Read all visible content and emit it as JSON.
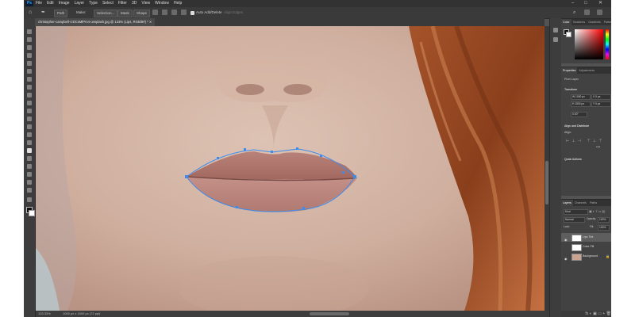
{
  "menubar": {
    "logo": "Ps",
    "items": [
      "File",
      "Edit",
      "Image",
      "Layer",
      "Type",
      "Select",
      "Filter",
      "3D",
      "View",
      "Window",
      "Help"
    ],
    "controls": [
      "–",
      "□",
      "✕"
    ]
  },
  "options": {
    "path_label": "Path",
    "make_label": "Make:",
    "selection": "Selection...",
    "mask": "Mask",
    "shape": "Shape",
    "auto_add_delete": "Auto Add/Delete",
    "align_edges": "Align Edges"
  },
  "document": {
    "tab_title": "christopher-campbell-rzDCsMlPm4-unsplash.jpg @ 133% (Lips, RGB/8#) * ✕"
  },
  "status": {
    "zoom": "133.33%",
    "doc_info": "1000 px x 1500 px (72 ppi)"
  },
  "color_panel": {
    "tabs": [
      "Color",
      "Swatches",
      "Gradients",
      "Patterns"
    ],
    "accent": "#ff0000"
  },
  "properties_panel": {
    "tabs": [
      "Properties",
      "Adjustments"
    ],
    "kind": "Pixel Layer",
    "transform_label": "Transform",
    "w": "W 1000 px",
    "x": "X 0 px",
    "h": "H 1500 px",
    "y": "Y 0 px",
    "angle": "0.00°",
    "align_label": "Align and Distribute",
    "align_sub": "Align:",
    "quick_label": "Quick Actions"
  },
  "layers_panel": {
    "tabs": [
      "Layers",
      "Channels",
      "Paths"
    ],
    "kind_filter": "Kind",
    "blend_mode": "Normal",
    "opacity_label": "Opacity:",
    "opacity_value": "100%",
    "lock_label": "Lock:",
    "fill_label": "Fill:",
    "fill_value": "100%",
    "layers": [
      {
        "name": "Lips Tint"
      },
      {
        "name": "Color Fill"
      },
      {
        "name": "Background"
      }
    ],
    "bottom_icons": "fx ◐ ▣ ▭ + 🗑"
  }
}
